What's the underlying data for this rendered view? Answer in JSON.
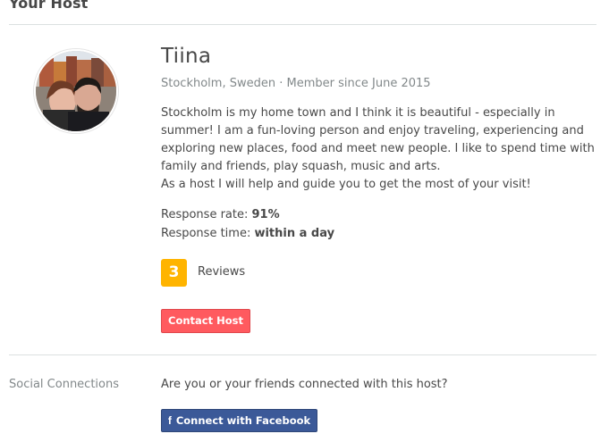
{
  "section": {
    "title": "Your Host"
  },
  "host": {
    "name": "Tiina",
    "location": "Stockholm, Sweden",
    "member_since": "Member since June 2015",
    "meta_separator": " · ",
    "about": [
      "Stockholm is my home town and I think it is beautiful - especially in summer! I am a fun-loving person and enjoy traveling, experiencing and exploring new places, food and meet new people. I like to spend time with family and friends, play squash, music and arts.",
      "As a host I will help and guide you to get the most of your visit!"
    ],
    "avatar_icon": "host-photo"
  },
  "stats": {
    "response_rate_label": "Response rate: ",
    "response_rate_value": "91%",
    "response_time_label": "Response time: ",
    "response_time_value": "within a day"
  },
  "reviews": {
    "count": "3",
    "label": "Reviews",
    "badge_color": "#ffb400"
  },
  "contact": {
    "button_label": "Contact Host",
    "button_color": "#ff5a5f"
  },
  "social": {
    "label": "Social Connections",
    "question": "Are you or your friends connected with this host?",
    "facebook_icon": "f",
    "facebook_label": "Connect with Facebook",
    "facebook_color": "#3b5998"
  }
}
